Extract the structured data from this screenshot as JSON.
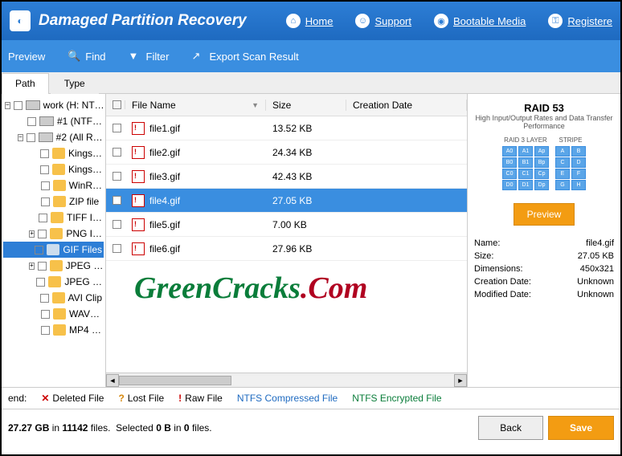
{
  "header": {
    "title": "Damaged Partition Recovery",
    "nav": [
      {
        "label": "Home"
      },
      {
        "label": "Support"
      },
      {
        "label": "Bootable Media"
      },
      {
        "label": "Registere"
      }
    ]
  },
  "toolbar": {
    "preview": "Preview",
    "find": "Find",
    "filter": "Filter",
    "export": "Export Scan Result"
  },
  "tabs": {
    "path": "Path",
    "type": "Type"
  },
  "tree": [
    {
      "label": "work (H: NT…",
      "level": 1,
      "exp": "minus",
      "icon": "drive"
    },
    {
      "label": "#1 (NTF…",
      "level": 2,
      "exp": "none",
      "icon": "drive"
    },
    {
      "label": "#2 (All R…",
      "level": 2,
      "exp": "minus",
      "icon": "drive"
    },
    {
      "label": "Kings…",
      "level": 3,
      "icon": "folder"
    },
    {
      "label": "Kings…",
      "level": 3,
      "icon": "folder"
    },
    {
      "label": "WinR…",
      "level": 3,
      "icon": "folder"
    },
    {
      "label": "ZIP file",
      "level": 3,
      "icon": "folder"
    },
    {
      "label": "TIFF I…",
      "level": 3,
      "icon": "folder"
    },
    {
      "label": "PNG I…",
      "level": 3,
      "icon": "folder",
      "exp": "plus"
    },
    {
      "label": "GIF Files",
      "level": 3,
      "icon": "folder",
      "selected": true
    },
    {
      "label": "JPEG …",
      "level": 3,
      "icon": "folder",
      "exp": "plus"
    },
    {
      "label": "JPEG …",
      "level": 3,
      "icon": "folder"
    },
    {
      "label": "AVI Clip",
      "level": 3,
      "icon": "folder"
    },
    {
      "label": "WAV…",
      "level": 3,
      "icon": "folder"
    },
    {
      "label": "MP4 …",
      "level": 3,
      "icon": "folder"
    }
  ],
  "columns": {
    "name": "File Name",
    "size": "Size",
    "date": "Creation Date"
  },
  "files": [
    {
      "name": "file1.gif",
      "size": "13.52 KB"
    },
    {
      "name": "file2.gif",
      "size": "24.34 KB"
    },
    {
      "name": "file3.gif",
      "size": "42.43 KB"
    },
    {
      "name": "file4.gif",
      "size": "27.05 KB",
      "selected": true
    },
    {
      "name": "file5.gif",
      "size": "7.00 KB"
    },
    {
      "name": "file6.gif",
      "size": "27.96 KB"
    }
  ],
  "preview": {
    "title": "RAID 53",
    "sub": "High Input/Output Rates and Data Transfer Performance",
    "col1": "RAID 3 LAYER",
    "col2": "STRIPE",
    "button": "Preview",
    "meta": [
      {
        "k": "Name:",
        "v": "file4.gif"
      },
      {
        "k": "Size:",
        "v": "27.05 KB"
      },
      {
        "k": "Dimensions:",
        "v": "450x321"
      },
      {
        "k": "Creation Date:",
        "v": "Unknown"
      },
      {
        "k": "Modified Date:",
        "v": "Unknown"
      }
    ]
  },
  "legend": {
    "label": "end:",
    "deleted": "Deleted File",
    "lost": "Lost File",
    "raw": "Raw File",
    "ntfs1": "NTFS Compressed File",
    "ntfs2": "NTFS Encrypted File"
  },
  "status": {
    "size": "27.27 GB",
    "filesword": "in",
    "files": "11142",
    "filesw2": "files.",
    "sel": "Selected",
    "selb": "0 B",
    "selin": "in",
    "self": "0",
    "selfw": "files.",
    "back": "Back",
    "save": "Save"
  },
  "watermark": {
    "p1": "Green",
    "p2": "Cracks",
    "p3": ".",
    "p4": "Com"
  }
}
